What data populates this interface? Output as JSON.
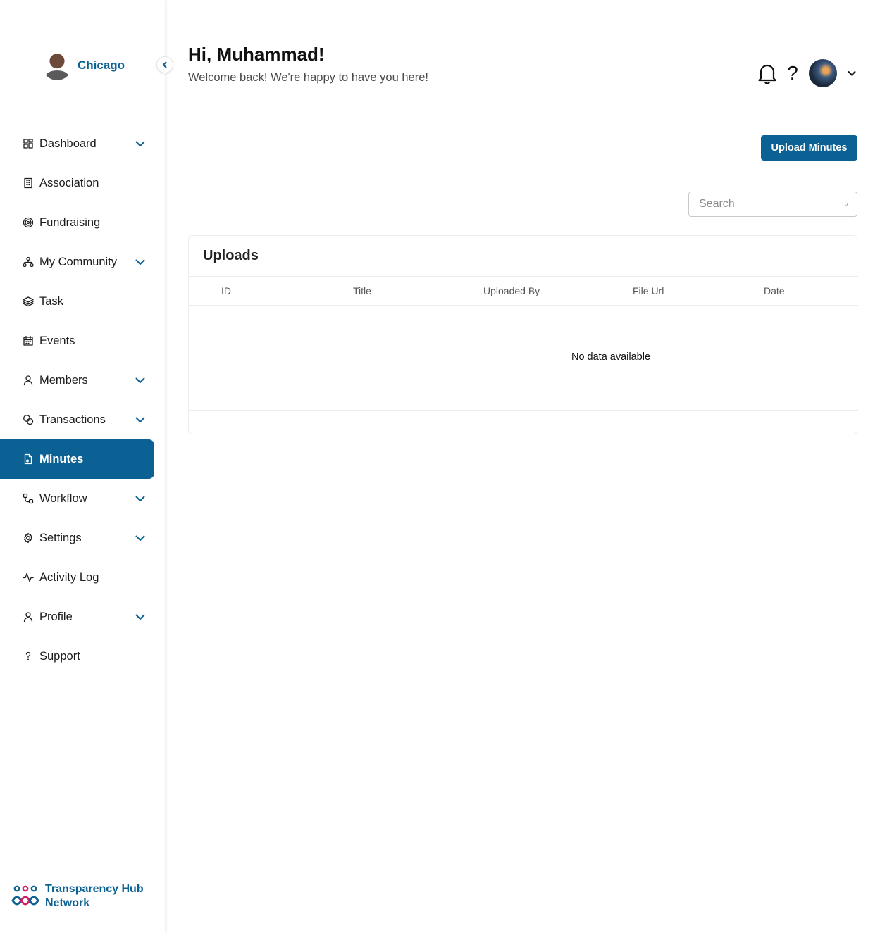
{
  "org": {
    "name": "Chicago"
  },
  "nav": [
    {
      "key": "dashboard",
      "label": "Dashboard",
      "icon": "dashboard-grid-icon",
      "expandable": true,
      "active": false
    },
    {
      "key": "association",
      "label": "Association",
      "icon": "building-icon",
      "expandable": false,
      "active": false
    },
    {
      "key": "fundraising",
      "label": "Fundraising",
      "icon": "target-icon",
      "expandable": false,
      "active": false
    },
    {
      "key": "my-community",
      "label": "My Community",
      "icon": "network-icon",
      "expandable": true,
      "active": false
    },
    {
      "key": "task",
      "label": "Task",
      "icon": "layers-icon",
      "expandable": false,
      "active": false
    },
    {
      "key": "events",
      "label": "Events",
      "icon": "calendar-icon",
      "expandable": false,
      "active": false
    },
    {
      "key": "members",
      "label": "Members",
      "icon": "user-icon",
      "expandable": true,
      "active": false
    },
    {
      "key": "transactions",
      "label": "Transactions",
      "icon": "coins-icon",
      "expandable": true,
      "active": false
    },
    {
      "key": "minutes",
      "label": "Minutes",
      "icon": "document-icon",
      "expandable": false,
      "active": true
    },
    {
      "key": "workflow",
      "label": "Workflow",
      "icon": "workflow-icon",
      "expandable": true,
      "active": false
    },
    {
      "key": "settings",
      "label": "Settings",
      "icon": "gear-icon",
      "expandable": true,
      "active": false
    },
    {
      "key": "activity-log",
      "label": "Activity Log",
      "icon": "activity-icon",
      "expandable": false,
      "active": false
    },
    {
      "key": "profile",
      "label": "Profile",
      "icon": "user-icon",
      "expandable": true,
      "active": false
    },
    {
      "key": "support",
      "label": "Support",
      "icon": "question-icon",
      "expandable": false,
      "active": false
    }
  ],
  "brand": {
    "line1": "Transparency Hub",
    "line2": "Network"
  },
  "header": {
    "greeting": "Hi, Muhammad!",
    "welcome": "Welcome back! We're happy to have you here!",
    "help_glyph": "?"
  },
  "actions": {
    "upload_label": "Upload Minutes"
  },
  "search": {
    "placeholder": "Search",
    "value": ""
  },
  "uploads": {
    "title": "Uploads",
    "columns": [
      "ID",
      "Title",
      "Uploaded By",
      "File Url",
      "Date"
    ],
    "rows": [],
    "empty_text": "No data available"
  },
  "colors": {
    "primary": "#0b6194",
    "text": "#1c1c1c",
    "border": "#ececec"
  }
}
